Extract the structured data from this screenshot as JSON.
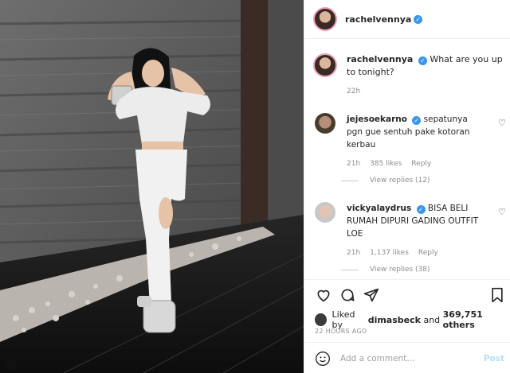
{
  "post": {
    "username": "rachelvennya",
    "caption": "What are you up to tonight?",
    "caption_time": "22h",
    "photo_alt": ""
  },
  "comments": [
    {
      "username": "jejesoekarno",
      "text": "sepatunya pgn gue sentuh pake kotoran kerbau",
      "time": "21h",
      "likes": "385 likes",
      "reply": "Reply",
      "view_replies": "View replies (12)"
    },
    {
      "username": "vickyalaydrus",
      "text": "BISA BELI RUMAH DIPURI GADING OUTFIT LOE",
      "time": "21h",
      "likes": "1,137 likes",
      "reply": "Reply",
      "view_replies": "View replies (38)"
    }
  ],
  "likes_line": {
    "prefix": "Liked by",
    "user": "dimasbeck",
    "and": "and",
    "count": "369,751 others"
  },
  "post_time": "22 HOURS AGO",
  "add_comment": {
    "placeholder": "Add a comment…",
    "post_label": "Post"
  },
  "icons": {
    "like": "heart-icon",
    "comment": "comment-icon",
    "share": "paper-plane-icon",
    "save": "bookmark-icon",
    "emoji": "smile-icon",
    "verified": "verified-badge-icon"
  },
  "colors": {
    "verified": "#3897f0",
    "muted": "#8e8e8e",
    "post_disabled": "#b2dffc"
  }
}
